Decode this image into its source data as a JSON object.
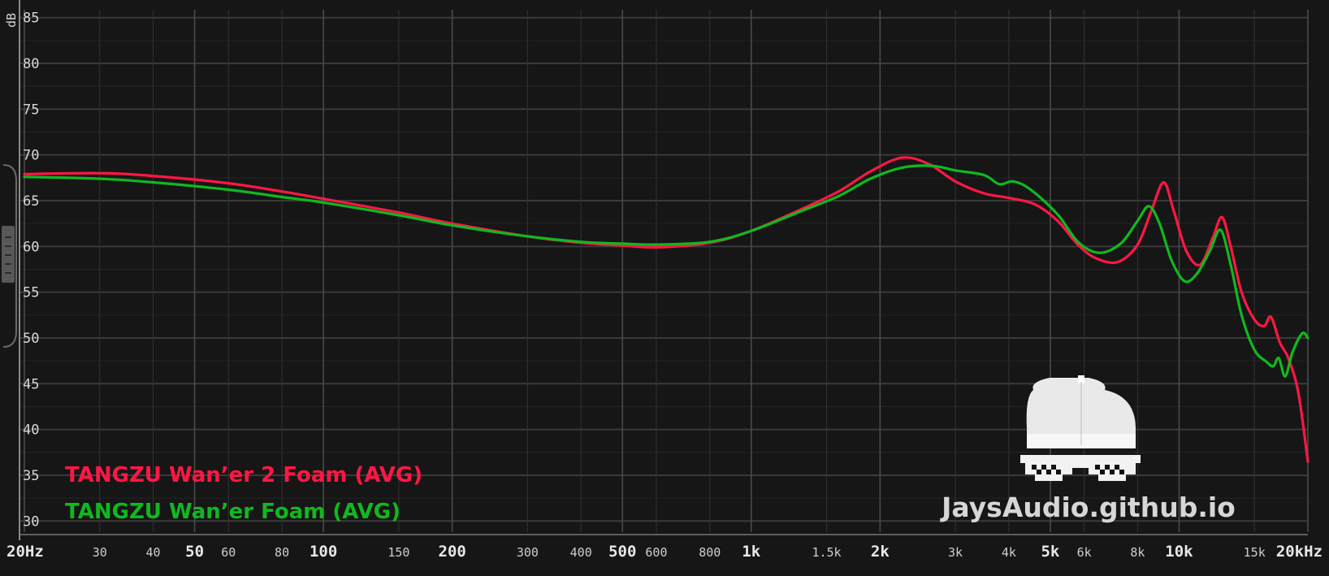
{
  "chart_data": {
    "type": "line",
    "x_scale": "log",
    "xlim": [
      20,
      20000
    ],
    "ylim": [
      28,
      86
    ],
    "ylabel": "dB",
    "yticks": [
      30,
      35,
      40,
      45,
      50,
      55,
      60,
      65,
      70,
      75,
      80,
      85
    ],
    "xticks": [
      {
        "v": 20,
        "label": "20Hz",
        "major": true
      },
      {
        "v": 30,
        "label": "30",
        "major": false
      },
      {
        "v": 40,
        "label": "40",
        "major": false
      },
      {
        "v": 50,
        "label": "50",
        "major": true
      },
      {
        "v": 60,
        "label": "60",
        "major": false
      },
      {
        "v": 80,
        "label": "80",
        "major": false
      },
      {
        "v": 100,
        "label": "100",
        "major": true
      },
      {
        "v": 150,
        "label": "150",
        "major": false
      },
      {
        "v": 200,
        "label": "200",
        "major": true
      },
      {
        "v": 300,
        "label": "300",
        "major": false
      },
      {
        "v": 400,
        "label": "400",
        "major": false
      },
      {
        "v": 500,
        "label": "500",
        "major": true
      },
      {
        "v": 600,
        "label": "600",
        "major": false
      },
      {
        "v": 800,
        "label": "800",
        "major": false
      },
      {
        "v": 1000,
        "label": "1k",
        "major": true
      },
      {
        "v": 1500,
        "label": "1.5k",
        "major": false
      },
      {
        "v": 2000,
        "label": "2k",
        "major": true
      },
      {
        "v": 3000,
        "label": "3k",
        "major": false
      },
      {
        "v": 4000,
        "label": "4k",
        "major": false
      },
      {
        "v": 5000,
        "label": "5k",
        "major": true
      },
      {
        "v": 6000,
        "label": "6k",
        "major": false
      },
      {
        "v": 8000,
        "label": "8k",
        "major": false
      },
      {
        "v": 10000,
        "label": "10k",
        "major": true
      },
      {
        "v": 15000,
        "label": "15k",
        "major": false
      },
      {
        "v": 20000,
        "label": "20kHz",
        "major": true
      }
    ],
    "grid": true,
    "legend_position": "bottom-left",
    "series": [
      {
        "name": "TANGZU Wan’er 2 Foam (AVG)",
        "color": "#ff1744",
        "points": [
          [
            20,
            67.9
          ],
          [
            30,
            68.0
          ],
          [
            40,
            67.7
          ],
          [
            60,
            66.9
          ],
          [
            80,
            66.0
          ],
          [
            100,
            65.2
          ],
          [
            150,
            63.7
          ],
          [
            200,
            62.5
          ],
          [
            300,
            61.1
          ],
          [
            400,
            60.4
          ],
          [
            500,
            60.1
          ],
          [
            600,
            59.9
          ],
          [
            800,
            60.4
          ],
          [
            1000,
            61.7
          ],
          [
            1300,
            64.0
          ],
          [
            1600,
            66.0
          ],
          [
            1900,
            68.2
          ],
          [
            2250,
            69.7
          ],
          [
            2600,
            69.0
          ],
          [
            3000,
            67.1
          ],
          [
            3500,
            65.8
          ],
          [
            4000,
            65.3
          ],
          [
            4600,
            64.6
          ],
          [
            5200,
            62.8
          ],
          [
            5800,
            60.2
          ],
          [
            6400,
            58.7
          ],
          [
            7200,
            58.3
          ],
          [
            8000,
            60.2
          ],
          [
            8600,
            63.8
          ],
          [
            9200,
            67.0
          ],
          [
            9700,
            64.0
          ],
          [
            10400,
            59.5
          ],
          [
            11200,
            58.0
          ],
          [
            12000,
            61.0
          ],
          [
            12600,
            63.2
          ],
          [
            13200,
            60.0
          ],
          [
            14000,
            55.0
          ],
          [
            15000,
            52.0
          ],
          [
            15800,
            51.3
          ],
          [
            16400,
            52.3
          ],
          [
            17200,
            49.5
          ],
          [
            18000,
            47.8
          ],
          [
            19000,
            44.0
          ],
          [
            20000,
            36.5
          ]
        ]
      },
      {
        "name": "TANGZU Wan’er Foam (AVG)",
        "color": "#10b81f",
        "points": [
          [
            20,
            67.6
          ],
          [
            30,
            67.4
          ],
          [
            40,
            67.0
          ],
          [
            60,
            66.2
          ],
          [
            80,
            65.4
          ],
          [
            100,
            64.8
          ],
          [
            150,
            63.4
          ],
          [
            200,
            62.3
          ],
          [
            300,
            61.1
          ],
          [
            400,
            60.5
          ],
          [
            500,
            60.3
          ],
          [
            600,
            60.2
          ],
          [
            800,
            60.5
          ],
          [
            1000,
            61.7
          ],
          [
            1300,
            63.8
          ],
          [
            1600,
            65.5
          ],
          [
            1900,
            67.4
          ],
          [
            2250,
            68.6
          ],
          [
            2650,
            68.8
          ],
          [
            3000,
            68.3
          ],
          [
            3500,
            67.8
          ],
          [
            3800,
            66.8
          ],
          [
            4100,
            67.1
          ],
          [
            4500,
            66.2
          ],
          [
            5200,
            63.5
          ],
          [
            5800,
            60.5
          ],
          [
            6500,
            59.3
          ],
          [
            7300,
            60.3
          ],
          [
            8000,
            62.8
          ],
          [
            8500,
            64.4
          ],
          [
            9000,
            62.5
          ],
          [
            9600,
            58.5
          ],
          [
            10300,
            56.2
          ],
          [
            11000,
            57.0
          ],
          [
            11800,
            59.5
          ],
          [
            12500,
            61.8
          ],
          [
            13200,
            58.0
          ],
          [
            14000,
            52.5
          ],
          [
            15000,
            48.7
          ],
          [
            16000,
            47.4
          ],
          [
            16600,
            46.9
          ],
          [
            17100,
            47.8
          ],
          [
            17700,
            45.8
          ],
          [
            18400,
            48.4
          ],
          [
            19400,
            50.5
          ],
          [
            20000,
            50.0
          ]
        ]
      }
    ]
  },
  "watermark": {
    "text": "JaysAudio.github.io",
    "logo_icon": "cap-and-pixel-sunglasses-icon"
  }
}
